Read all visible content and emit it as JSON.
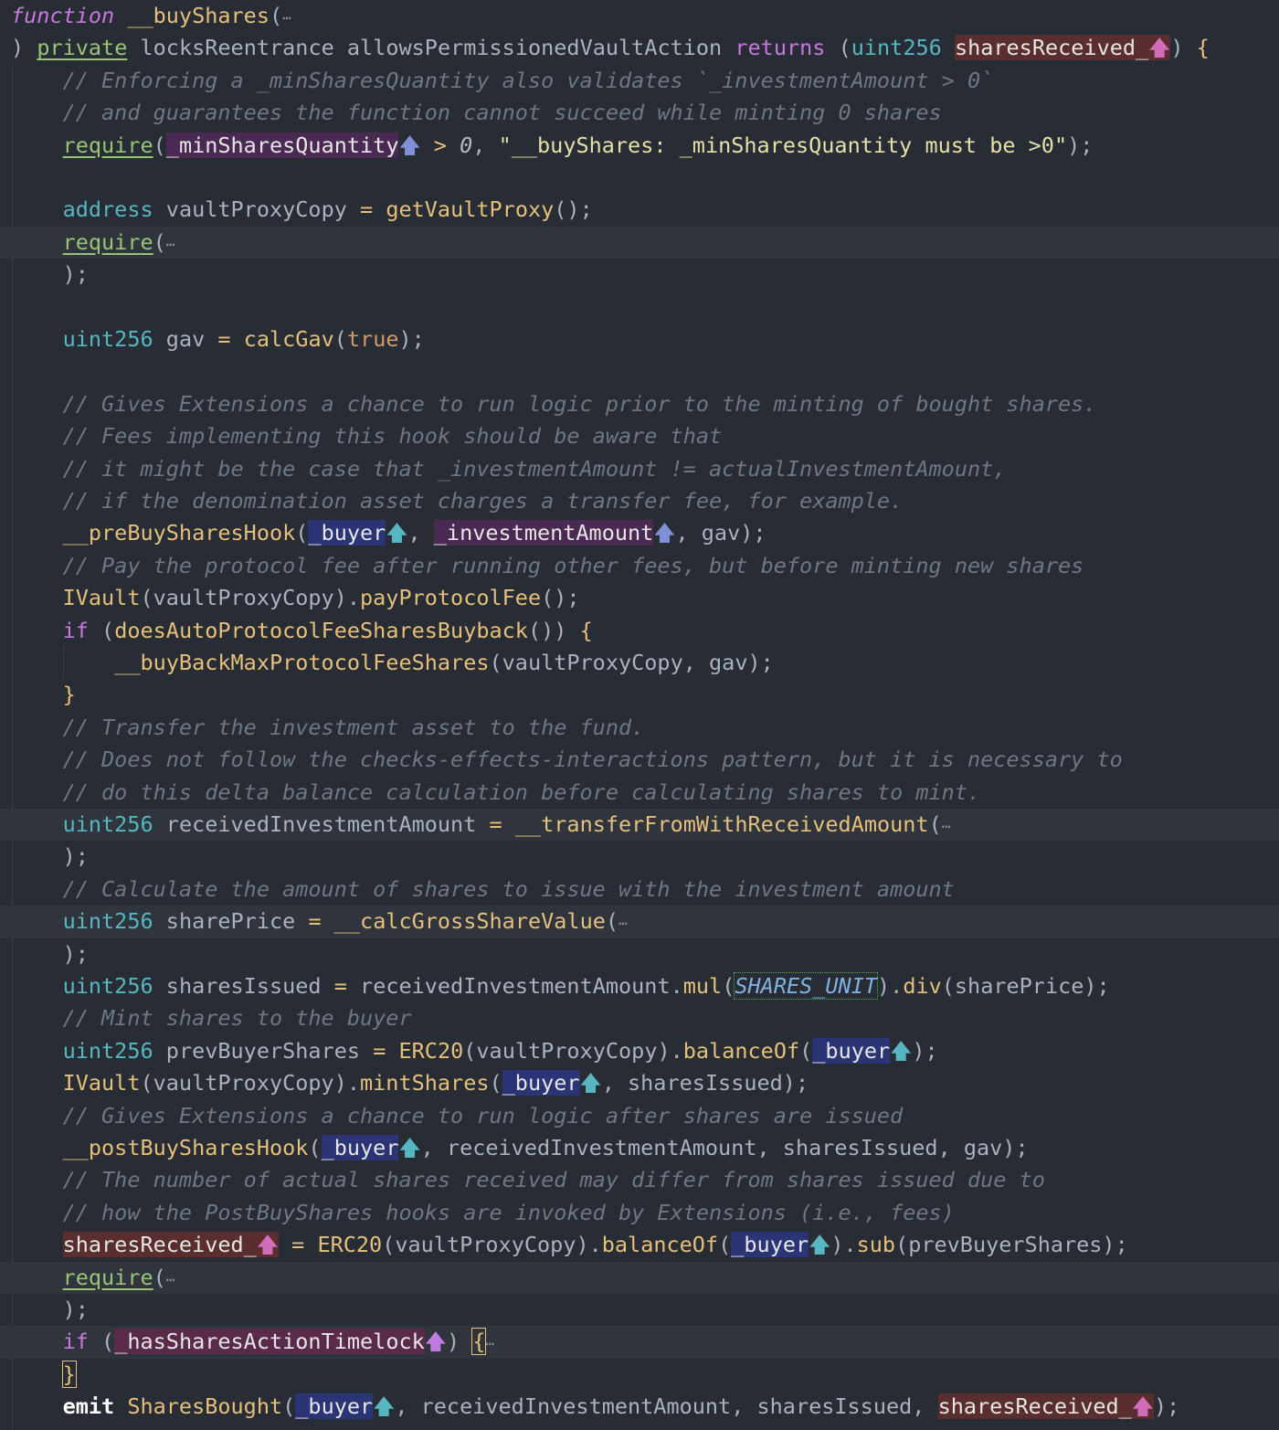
{
  "code": {
    "line1": {
      "keyword": "function",
      "name": "__buyShares",
      "open": "(",
      "ellipsis": "⋯"
    },
    "line2": {
      "close": ")",
      "mod1": "private",
      "mod2": "locksReentrance",
      "mod3": "allowsPermissionedVaultAction",
      "returns": "returns",
      "paren_open": "(",
      "ret_type": "uint256",
      "ret_name": "sharesReceived_",
      "arrow": "🡅",
      "paren_close": ")",
      "brace": "{"
    },
    "c1": "// Enforcing a _minSharesQuantity also validates `_investmentAmount > 0`",
    "c2": "// and guarantees the function cannot succeed while minting 0 shares",
    "req1": {
      "fn": "require",
      "open": "(",
      "param": "_minSharesQuantity",
      "arrow": "🡅",
      "op": ">",
      "num": "0",
      "comma": ",",
      "str": "\"__buyShares: _minSharesQuantity must be >0\"",
      "close": ");"
    },
    "vault": {
      "type": "address",
      "var": "vaultProxyCopy",
      "op": "=",
      "fn": "getVaultProxy",
      "tail": "();"
    },
    "req2": {
      "fn": "require",
      "open": "(",
      "ellipsis": "⋯"
    },
    "close_paren": ");",
    "gav": {
      "type": "uint256",
      "var": "gav",
      "op": "=",
      "fn": "calcGav",
      "open": "(",
      "arg": "true",
      "close": ");"
    },
    "c3": "// Gives Extensions a chance to run logic prior to the minting of bought shares.",
    "c4": "// Fees implementing this hook should be aware that",
    "c5": "// it might be the case that _investmentAmount != actualInvestmentAmount,",
    "c6": "// if the denomination asset charges a transfer fee, for example.",
    "prehook": {
      "fn": "__preBuySharesHook",
      "open": "(",
      "p1": "_buyer",
      "arrow": "🡅",
      "comma": ", ",
      "p2": "_investmentAmount",
      "rest": ", gav);"
    },
    "c7": "// Pay the protocol fee after running other fees, but before minting new shares",
    "payfee": {
      "cls": "IVault",
      "arg": "(vaultProxyCopy).",
      "fn": "payProtocolFee",
      "tail": "();"
    },
    "ifauto": {
      "kw": "if",
      "open": "(",
      "fn": "doesAutoProtocolFeeSharesBuyback",
      "tail": "())",
      "brace": "{"
    },
    "buyback": {
      "fn": "__buyBackMaxProtocolFeeShares",
      "tail": "(vaultProxyCopy, gav);"
    },
    "rbrace": "}",
    "c8": "// Transfer the investment asset to the fund.",
    "c9": "// Does not follow the checks-effects-interactions pattern, but it is necessary to",
    "c10": "// do this delta balance calculation before calculating shares to mint.",
    "recv": {
      "type": "uint256",
      "var": "receivedInvestmentAmount",
      "op": "=",
      "fn": "__transferFromWithReceivedAmount",
      "open": "(",
      "ellipsis": "⋯"
    },
    "c11": "// Calculate the amount of shares to issue with the investment amount",
    "price": {
      "type": "uint256",
      "var": "sharePrice",
      "op": "=",
      "fn": "__calcGrossShareValue",
      "open": "(",
      "ellipsis": "⋯"
    },
    "issued": {
      "type": "uint256",
      "var": "sharesIssued",
      "op": "=",
      "obj": "receivedInvestmentAmount.",
      "fn1": "mul",
      "const": "SHARES_UNIT",
      "mid": ").",
      "fn2": "div",
      "tail": "(sharePrice);"
    },
    "c12": "// Mint shares to the buyer",
    "prev": {
      "type": "uint256",
      "var": "prevBuyerShares",
      "op": "=",
      "cls": "ERC20",
      "arg": "(vaultProxyCopy).",
      "fn": "balanceOf",
      "open": "(",
      "p": "_buyer",
      "arrow": "🡅",
      "close": ");"
    },
    "mint": {
      "cls": "IVault",
      "arg": "(vaultProxyCopy).",
      "fn": "mintShares",
      "open": "(",
      "p": "_buyer",
      "arrow": "🡅",
      "tail": ", sharesIssued);"
    },
    "c13": "// Gives Extensions a chance to run logic after shares are issued",
    "posthook": {
      "fn": "__postBuySharesHook",
      "open": "(",
      "p": "_buyer",
      "arrow": "🡅",
      "tail": ", receivedInvestmentAmount, sharesIssued, gav);"
    },
    "c14": "// The number of actual shares received may differ from shares issued due to",
    "c15": "// how the PostBuyShares hooks are invoked by Extensions (i.e., fees)",
    "assign": {
      "var": "sharesReceived_",
      "arrow": "🡅",
      "op": "=",
      "cls": "ERC20",
      "arg": "(vaultProxyCopy).",
      "fn": "balanceOf",
      "open": "(",
      "p": "_buyer",
      "arrow2": "🡅",
      "mid": ").",
      "fn2": "sub",
      "tail": "(prevBuyerShares);"
    },
    "req3": {
      "fn": "require",
      "open": "(",
      "ellipsis": "⋯"
    },
    "iftl": {
      "kw": "if",
      "open": "(",
      "p": "_hasSharesActionTimelock",
      "arrow": "🡅",
      "close": ")",
      "brace": "{",
      "ellipsis": "⋯"
    },
    "rbrace2": "}",
    "emit": {
      "kw": "emit",
      "fn": "SharesBought",
      "open": "(",
      "p1": "_buyer",
      "arrow": "🡅",
      "mid": ", receivedInvestmentAmount, sharesIssued, ",
      "p2": "sharesReceived_",
      "arrow2": "🡅",
      "close": ");"
    }
  }
}
